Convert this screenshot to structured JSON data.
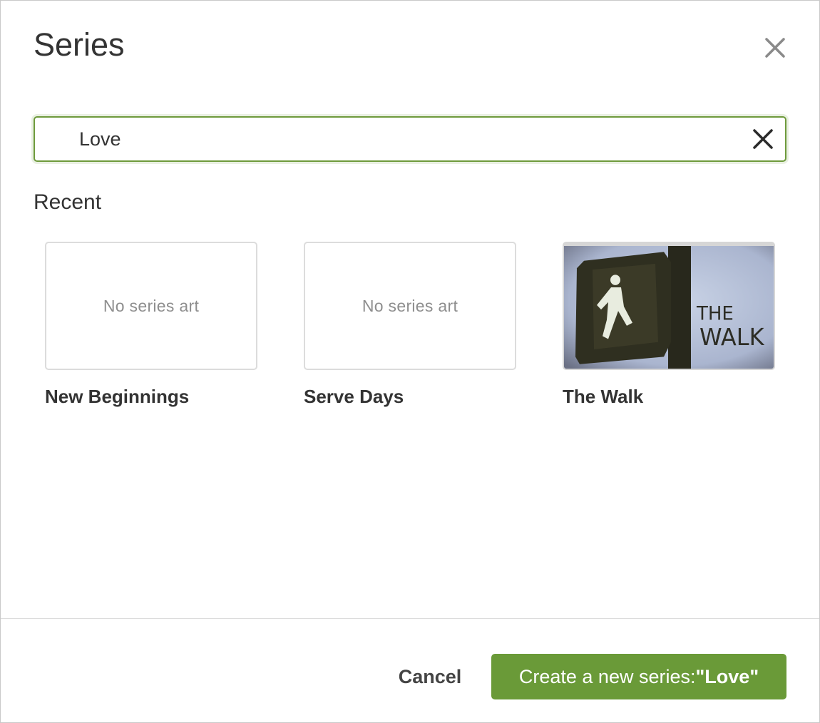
{
  "dialog": {
    "title": "Series",
    "close_icon": "close-icon"
  },
  "search": {
    "value": "Love",
    "clear_icon": "clear-search-icon"
  },
  "recent": {
    "heading": "Recent",
    "placeholder_text": "No series art",
    "items": [
      {
        "title": "New Beginnings",
        "has_art": false
      },
      {
        "title": "Serve Days",
        "has_art": false
      },
      {
        "title": "The Walk",
        "has_art": true,
        "art_text_line1": "THE",
        "art_text_line2": "WALK"
      }
    ]
  },
  "footer": {
    "cancel_label": "Cancel",
    "create_prefix": "Create a new series:",
    "create_value": "\"Love\""
  },
  "colors": {
    "accent": "#6a9a38",
    "focus_border": "#6e9a3c",
    "text": "#333333",
    "muted": "#8e8e8e"
  }
}
